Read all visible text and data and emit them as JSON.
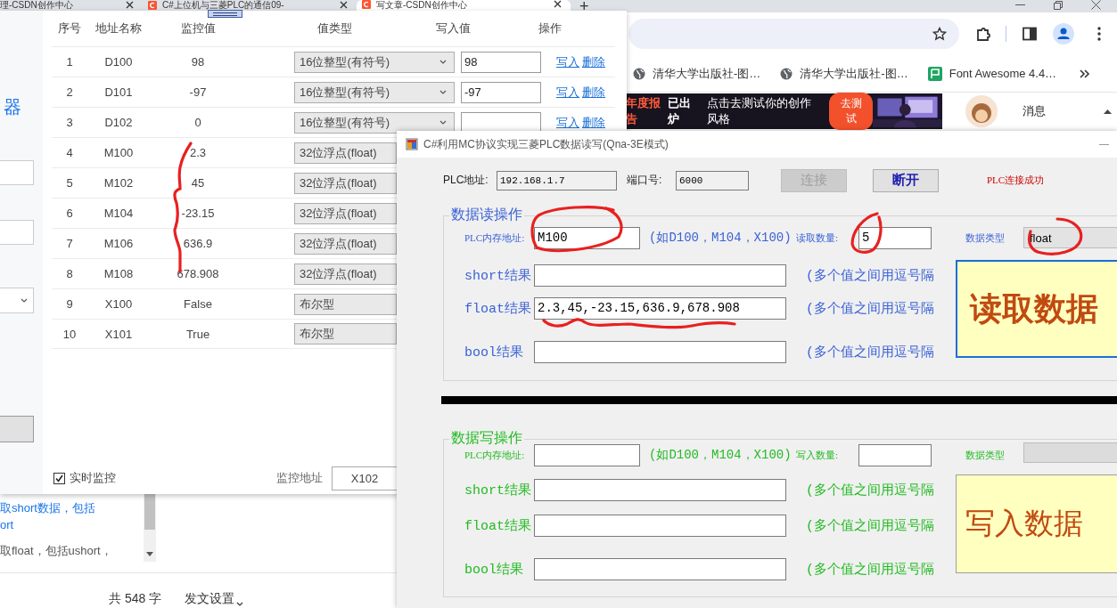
{
  "browser": {
    "tabs": [
      {
        "title": "理-CSDN创作中心",
        "favicon": false,
        "selected": false
      },
      {
        "title": "C#上位机与三菱PLC的通信09-",
        "favicon": true,
        "selected": false
      },
      {
        "title": "写文章-CSDN创作中心",
        "favicon": true,
        "selected": true
      }
    ],
    "new_tab": "+",
    "bookmarks": [
      {
        "label": "清华大学出版社-图…",
        "kind": "globe"
      },
      {
        "label": "清华大学出版社-图…",
        "kind": "globe"
      },
      {
        "label": "Font Awesome 4.4…",
        "kind": "flag"
      }
    ]
  },
  "page": {
    "banner": {
      "highlight": "年度报告",
      "emphasis": "已出炉",
      "text": "点击去测试你的创作风格",
      "button": "去测试"
    },
    "messages": "消息",
    "snippets": [
      {
        "text": "取short数据，包括",
        "kind": "link"
      },
      {
        "text": "ort",
        "kind": "link"
      },
      {
        "text": "取float，包括ushort，",
        "kind": "plain"
      }
    ],
    "word_count": "共 548 字",
    "publish_settings": "发文设置"
  },
  "monitor_window": {
    "side_title": "器",
    "columns": [
      "序号",
      "地址名称",
      "监控值",
      "值类型",
      "写入值",
      "操作"
    ],
    "rows": [
      {
        "index": "1",
        "address": "D100",
        "value": "98",
        "type": "16位整型(有符号)",
        "write_value": "98",
        "actions": [
          "写入",
          "删除"
        ]
      },
      {
        "index": "2",
        "address": "D101",
        "value": "-97",
        "type": "16位整型(有符号)",
        "write_value": "-97",
        "actions": [
          "写入",
          "删除"
        ]
      },
      {
        "index": "3",
        "address": "D102",
        "value": "0",
        "type": "16位整型(有符号)",
        "actions": [
          "写入",
          "删除"
        ]
      },
      {
        "index": "4",
        "address": "M100",
        "value": "2.3",
        "type": "32位浮点(float)"
      },
      {
        "index": "5",
        "address": "M102",
        "value": "45",
        "type": "32位浮点(float)"
      },
      {
        "index": "6",
        "address": "M104",
        "value": "-23.15",
        "type": "32位浮点(float)"
      },
      {
        "index": "7",
        "address": "M106",
        "value": "636.9",
        "type": "32位浮点(float)"
      },
      {
        "index": "8",
        "address": "M108",
        "value": "678.908",
        "type": "32位浮点(float)"
      },
      {
        "index": "9",
        "address": "X100",
        "value": "False",
        "type": "布尔型"
      },
      {
        "index": "10",
        "address": "X101",
        "value": "True",
        "type": "布尔型"
      }
    ],
    "realtime": {
      "label": "实时监控",
      "checked": true
    },
    "address_label": "监控地址",
    "address_value": "X102"
  },
  "plc_window": {
    "title": "C#利用MC协议实现三菱PLC数据读写(Qna-3E模式)",
    "connection": {
      "ip_label": "PLC地址:",
      "ip": "192.168.1.7",
      "port_label": "端口号:",
      "port": "6000",
      "buttons": [
        {
          "label": "连接",
          "disabled": true
        },
        {
          "label": "断开",
          "disabled": false
        }
      ],
      "status": "PLC连接成功"
    },
    "groups": [
      {
        "kind": "read",
        "title": "数据读操作",
        "address_label": "PLC内存地址:",
        "address": "M100",
        "address_hint": "(如D100，M104，X100)",
        "count_label": "读取数量:",
        "count": "5",
        "type_label": "数据类型",
        "type": "float",
        "results": [
          {
            "label": "short结果",
            "hint": "(多个值之间用逗号隔"
          },
          {
            "label": "float结果",
            "value": "2.3,45,-23.15,636.9,678.908",
            "hint": "(多个值之间用逗号隔"
          },
          {
            "label": "bool结果",
            "hint": "(多个值之间用逗号隔"
          }
        ],
        "action": "读取数据",
        "focused": true
      },
      {
        "kind": "write",
        "title": "数据写操作",
        "address_label": "PLC内存地址:",
        "address_hint": "(如D100，M104，X100)",
        "count_label": "写入数量:",
        "type_label": "数据类型",
        "results": [
          {
            "label": "short结果",
            "hint": "(多个值之间用逗号隔"
          },
          {
            "label": "float结果",
            "hint": "(多个值之间用逗号隔"
          },
          {
            "label": "bool结果",
            "hint": "(多个值之间用逗号隔"
          }
        ],
        "action": "写入数据",
        "focused": false
      }
    ]
  }
}
